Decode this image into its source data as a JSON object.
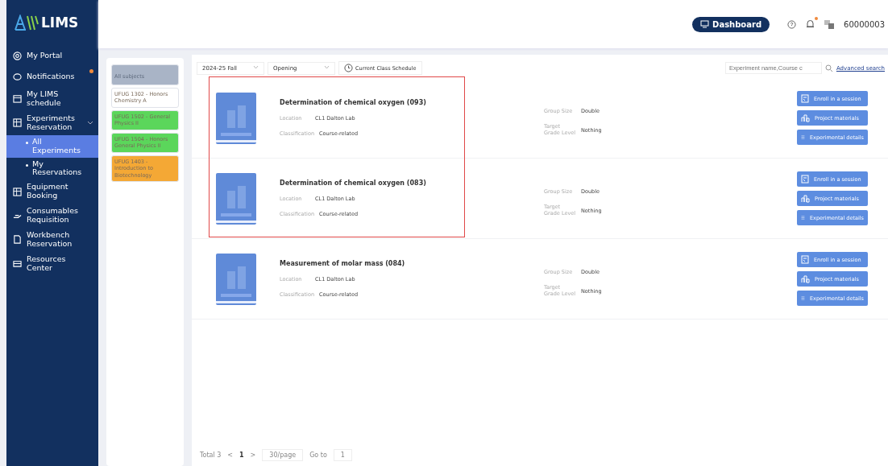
{
  "brand": {
    "name": "LIMS"
  },
  "sidebar": {
    "items": [
      {
        "label": "My Portal",
        "badge": false,
        "selected": false
      },
      {
        "label": "Notifications",
        "badge": true,
        "selected": false
      },
      {
        "label": "My LIMS schedule",
        "badge": false,
        "selected": false
      },
      {
        "label": "Experiments Reservation",
        "badge": false,
        "selected": false,
        "expanded": true,
        "children": [
          {
            "label": "All Experiments",
            "selected": true
          },
          {
            "label": "My Reservations",
            "selected": false
          }
        ]
      },
      {
        "label": "Equipment Booking",
        "badge": false,
        "selected": false
      },
      {
        "label": "Consumables Requisition",
        "badge": false,
        "selected": false
      },
      {
        "label": "Workbench Reservation",
        "badge": false,
        "selected": false
      },
      {
        "label": "Resources Center",
        "badge": false,
        "selected": false
      }
    ]
  },
  "header": {
    "dashboard_button": "Dashboard",
    "user": "60000003",
    "notification_dot": true
  },
  "subjects": [
    {
      "label": "All subjects",
      "color": "#a9b4c6"
    },
    {
      "label": "UFUG 1302 - Honors Chemistry A",
      "color": "#ffffff"
    },
    {
      "label": "UFUG 1502 - General Physics II",
      "color": "#5bd65b"
    },
    {
      "label": "UFUG 1504 - Honors General Physics II",
      "color": "#5bd65b"
    },
    {
      "label": "UFUG 1403 - Introduction to Biotechnology",
      "color": "#f4a835"
    }
  ],
  "filters": {
    "term": "2024-25 Fall",
    "status": "Opening",
    "schedule_button": "Current Class Schedule",
    "search_placeholder": "Experiment name,Course c",
    "advanced_search": "Advanced search"
  },
  "experiments": [
    {
      "title": "Determination of chemical oxygen  (093)",
      "location_label": "Location",
      "location": "CL1 Dalton Lab",
      "classification_label": "Classification",
      "classification": "Course-related",
      "group_size_label": "Group Size",
      "group_size": "Double",
      "grade_label": "Target Grade Level",
      "grade": "Nothing",
      "highlighted": true,
      "buttons": [
        "Enroll in a session",
        "Project materials",
        "Experimental details"
      ]
    },
    {
      "title": "Determination of chemical oxygen  (083)",
      "location_label": "Location",
      "location": "CL1 Dalton Lab",
      "classification_label": "Classification",
      "classification": "Course-related",
      "group_size_label": "Group Size",
      "group_size": "Double",
      "grade_label": "Target Grade Level",
      "grade": "Nothing",
      "highlighted": true,
      "buttons": [
        "Enroll in a session",
        "Project materials",
        "Experimental details"
      ]
    },
    {
      "title": "Measurement of molar mass  (084)",
      "location_label": "Location",
      "location": "CL1 Dalton Lab",
      "classification_label": "Classification",
      "classification": "Course-related",
      "group_size_label": "Group Size",
      "group_size": "Double",
      "grade_label": "Target Grade Level",
      "grade": "Nothing",
      "highlighted": false,
      "buttons": [
        "Enroll in a session",
        "Project materials",
        "Experimental details"
      ]
    }
  ],
  "pagination": {
    "total": "Total 3",
    "prev": "<",
    "page": "1",
    "next": ">",
    "page_size": "30/page",
    "goto_label": "Go to",
    "goto_value": "1"
  }
}
